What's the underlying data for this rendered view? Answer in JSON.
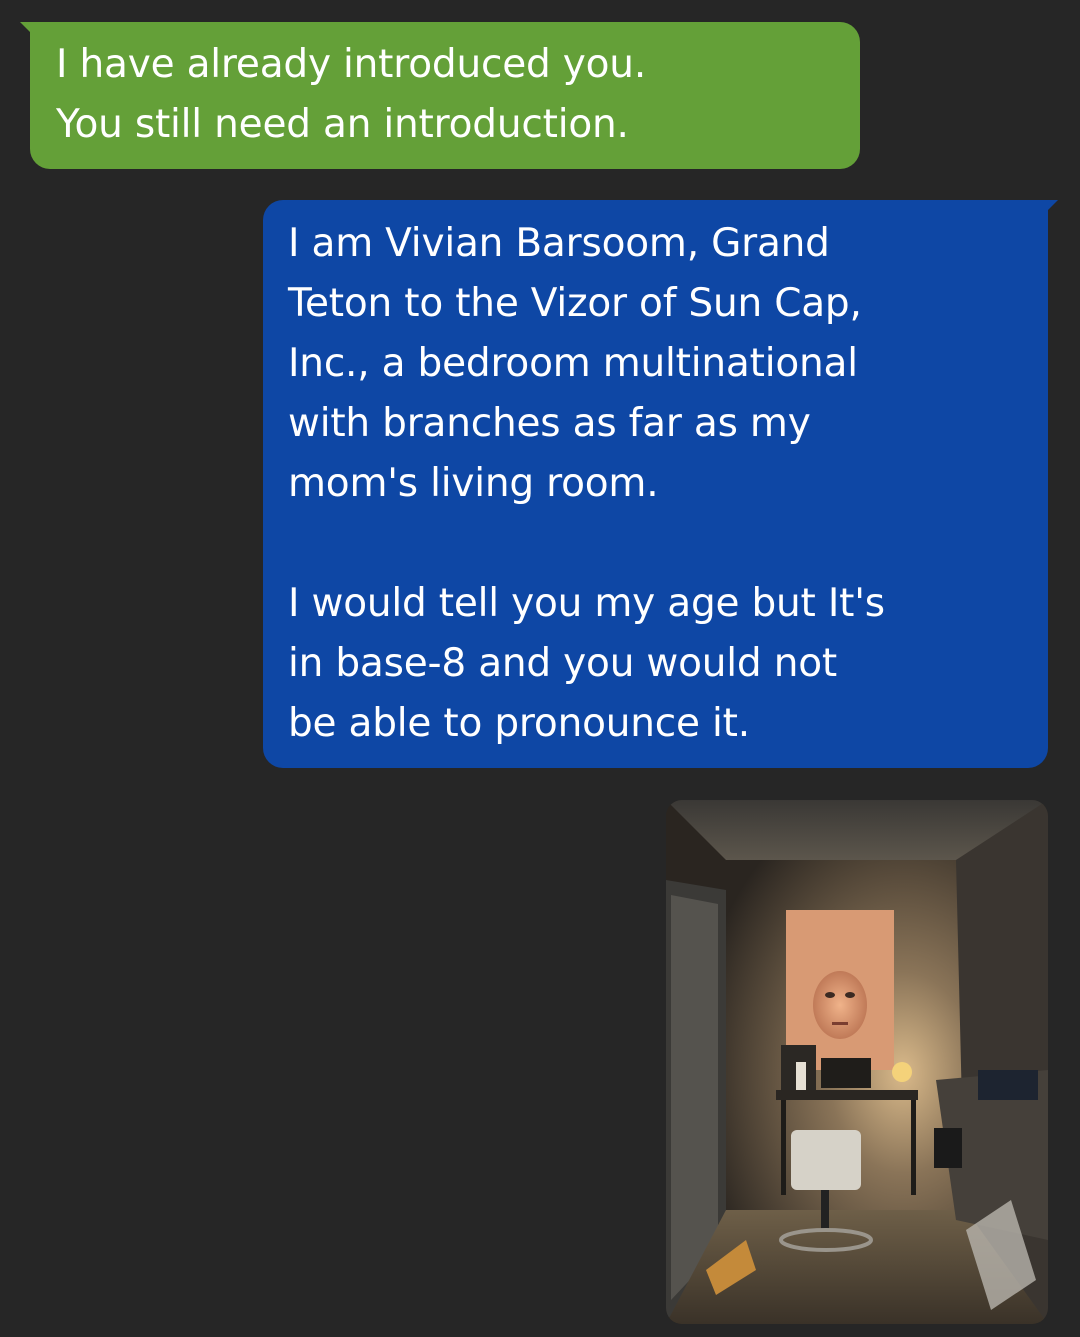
{
  "conversation": {
    "messages": [
      {
        "direction": "incoming",
        "color": "#64a038",
        "text": "I have already introduced you.\nYou still need an introduction."
      },
      {
        "direction": "outgoing",
        "color": "#0e47a5",
        "text": "I am Vivian Barsoom, Grand\nTeton to the Vizor of Sun Cap,\nInc., a bedroom multinational\nwith branches as far as my\nmom's living room.\n\nI would tell you my age but It's\nin base-8 and you would not\nbe able to pronounce it."
      }
    ],
    "attachment": {
      "type": "photo",
      "icon": "photo-of-bedroom-desk"
    }
  }
}
